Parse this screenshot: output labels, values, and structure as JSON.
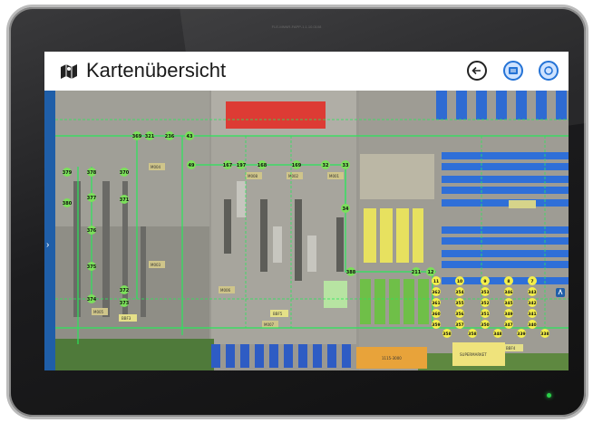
{
  "device": {
    "top_label": "FLE-MNNR-FAPP-1.1.10.0108"
  },
  "header": {
    "title": "Kartenübersicht",
    "icon": "map-area-icon",
    "buttons": [
      {
        "icon": "back-arrow-icon"
      },
      {
        "icon": "map-overview-icon"
      },
      {
        "icon": "map-refresh-icon"
      }
    ]
  },
  "sidebar": {
    "toggle_glyph": "›"
  },
  "map": {
    "route_nodes": {
      "top_row": [
        "369",
        "321",
        "236",
        "43"
      ],
      "middle_row": [
        "49",
        "167",
        "197",
        "168",
        "169",
        "32",
        "33"
      ],
      "left_column": [
        "378",
        "377",
        "376",
        "375",
        "374",
        "380",
        "379"
      ],
      "second_column": [
        "370",
        "371",
        "372",
        "373"
      ],
      "right_column": [
        "34",
        "388",
        "211",
        "12"
      ],
      "cluster_row1": [
        "11",
        "10",
        "9",
        "8",
        "7"
      ],
      "cluster_row2": [
        "362",
        "354",
        "353",
        "346",
        "343"
      ],
      "cluster_row3": [
        "361",
        "355",
        "352",
        "345",
        "342"
      ],
      "cluster_row4": [
        "360",
        "356",
        "351",
        "349",
        "341"
      ],
      "cluster_row5": [
        "359",
        "357",
        "350",
        "347",
        "340"
      ],
      "cluster_row6": [
        "358",
        "358",
        "348",
        "339",
        "338"
      ]
    },
    "area_labels": {
      "supermarket": "SUPERMARKET",
      "big_orange": "1115-3000",
      "bbf4": "BBF4",
      "bbf3": "BBF3",
      "bbf5": "BBF5",
      "m004": "M004",
      "m003": "M003",
      "m005": "M005",
      "m006": "M006",
      "m007": "M007",
      "m008": "M008",
      "m002": "M002",
      "m001": "M001"
    }
  }
}
